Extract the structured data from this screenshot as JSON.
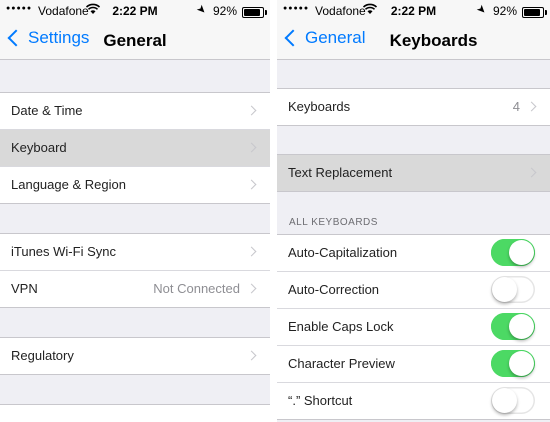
{
  "colors": {
    "accent": "#007aff",
    "toggle_on": "#4cd964",
    "highlight": "#d9d9d9",
    "background": "#efeff4"
  },
  "left": {
    "status": {
      "carrier": "Vodafone",
      "time": "2:22 PM",
      "battery": "92%",
      "battery_level": 0.92
    },
    "nav": {
      "back_label": "Settings",
      "title": "General"
    },
    "groups": {
      "a": [
        {
          "label": "Date & Time"
        },
        {
          "label": "Keyboard"
        },
        {
          "label": "Language & Region"
        }
      ],
      "b": [
        {
          "label": "iTunes Wi-Fi Sync"
        },
        {
          "label": "VPN",
          "value": "Not Connected"
        }
      ],
      "c": [
        {
          "label": "Regulatory"
        }
      ]
    }
  },
  "right": {
    "status": {
      "carrier": "Vodafone",
      "time": "2:22 PM",
      "battery": "92%",
      "battery_level": 0.92
    },
    "nav": {
      "back_label": "General",
      "title": "Keyboards"
    },
    "keyboards_row": {
      "label": "Keyboards",
      "value": "4"
    },
    "text_replacement": {
      "label": "Text Replacement"
    },
    "section_header": "ALL KEYBOARDS",
    "toggles": [
      {
        "label": "Auto-Capitalization",
        "on": true
      },
      {
        "label": "Auto-Correction",
        "on": false
      },
      {
        "label": "Enable Caps Lock",
        "on": true
      },
      {
        "label": "Character Preview",
        "on": true
      },
      {
        "label": "“.” Shortcut",
        "on": false
      }
    ]
  }
}
